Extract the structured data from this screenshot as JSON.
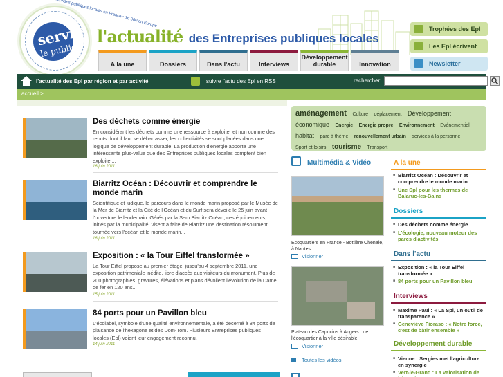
{
  "logo": {
    "line1": "servir",
    "line2": "le public",
    "ring_text": "• 1 100 entreprises publiques locales en France • 16 000 en Europe"
  },
  "site_title": {
    "part1": "l'actualité",
    "part2": "des Entreprises publiques locales"
  },
  "nav": {
    "tabs": [
      {
        "label": "A la une",
        "color": "#f39a1e"
      },
      {
        "label": "Dossiers",
        "color": "#1ba3c6"
      },
      {
        "label": "Dans l'actu",
        "color": "#2f6e8f"
      },
      {
        "label": "Interviews",
        "color": "#8c1a3e"
      },
      {
        "label": "Développement durable",
        "color": "#8bb636"
      },
      {
        "label": "Innovation",
        "color": "#5f7f94"
      }
    ]
  },
  "header_buttons": [
    {
      "label": "Trophées des Epl",
      "bg": "#cfe1a2",
      "fg": "#2f4a1c"
    },
    {
      "label": "Les Epl écrivent",
      "bg": "#cfe1a2",
      "fg": "#2f4a1c"
    },
    {
      "label": "Newsletter",
      "bg": "#cfe6f2",
      "fg": "#2a6f9c"
    }
  ],
  "topbar": {
    "region_label": "l'actualité des Epl par région et par activité",
    "rss_label": "suivre l'actu des Epl en RSS",
    "search_label": "rechercher",
    "search_value": ""
  },
  "breadcrumb": "accueil >",
  "articles": [
    {
      "title": "Des déchets comme énergie",
      "summary": "En considérant les déchets comme une ressource à exploiter et non comme des rebuts dont il faut se débarrasser, les collectivités se sont placées dans une logique de développement durable. La production d'énergie apporte une intéressante plus-value que des Entreprises publiques locales comptent bien exploiter...",
      "date": "16 juin 2011"
    },
    {
      "title": "Biarritz Océan : Découvrir et comprendre le monde marin",
      "summary": "Scientifique et ludique, le parcours dans le monde marin proposé par le Musée de la Mer de Biarritz et la Cité de l'Océan et du Surf sera dévoilé le 25 juin avant l'ouverture le lendemain. Gérés par la Sem Biarritz Océan, ces équipements, initiés par la municipalité, visent à faire de Biarritz une destination résolument tournée vers l'océan et le monde marin...",
      "date": "16 juin 2011"
    },
    {
      "title": "Exposition : « la Tour Eiffel transformée »",
      "summary": "La Tour Eiffel propose au premier étage, jusqu'au 4 septembre 2011, une exposition patrimoniale inédite, libre d'accès aux visiteurs du monument. Plus de 200 photographies, gravures, élévations et plans dévoilent l'évolution de la Dame de fer en 120 ans...",
      "date": "15 juin 2011"
    },
    {
      "title": "84 ports pour un Pavillon bleu",
      "summary": "L'écolabel, symbole d'une qualité environnementale, a été décerné à 84 ports de plaisance de l'hexagone et des Dom-Tom. Plusieurs Entreprises publiques locales (Epl) voient leur engagement reconnu.",
      "date": "14 juin 2011"
    }
  ],
  "tags": [
    {
      "text": "aménagement",
      "size": 11,
      "bold": true
    },
    {
      "text": "Culture",
      "size": 7,
      "bold": false
    },
    {
      "text": "déplacement",
      "size": 7,
      "bold": false
    },
    {
      "text": "Développement",
      "size": 9,
      "bold": false
    },
    {
      "text": "économique",
      "size": 9,
      "bold": false
    },
    {
      "text": "Energie",
      "size": 7,
      "bold": true
    },
    {
      "text": "Energie propre",
      "size": 7,
      "bold": true
    },
    {
      "text": "Environnement",
      "size": 7,
      "bold": true
    },
    {
      "text": "Evénementiel",
      "size": 7,
      "bold": false
    },
    {
      "text": "habitat",
      "size": 9,
      "bold": false
    },
    {
      "text": "parc à thème",
      "size": 7,
      "bold": false
    },
    {
      "text": "renouvellement urbain",
      "size": 7,
      "bold": true
    },
    {
      "text": "services à la personne",
      "size": 7,
      "bold": false
    },
    {
      "text": "Sport et loisirs",
      "size": 7,
      "bold": false
    },
    {
      "text": "tourisme",
      "size": 10,
      "bold": true
    },
    {
      "text": "Transport",
      "size": 7,
      "bold": false
    }
  ],
  "multimedia": {
    "title": "Multimédia & Vidéo",
    "items": [
      {
        "caption": "Ecoquartiers en France - Bottière Chénaie, à Nantes",
        "link": "Visionner"
      },
      {
        "caption": "Plateau des Capucins à Angers : de l'écoquartier à la ville désirable",
        "link": "Visionner"
      }
    ],
    "all_videos": "Toutes les vidéos"
  },
  "news": {
    "sections": [
      {
        "title": "A la une",
        "color": "#f39a1e",
        "items": [
          {
            "text": "Biarritz Océan : Découvrir et comprendre le monde marin",
            "green": false
          },
          {
            "text": "Une Spl pour les thermes de Balaruc-les-Bains",
            "green": true
          }
        ]
      },
      {
        "title": "Dossiers",
        "color": "#1ba3c6",
        "items": [
          {
            "text": "Des déchets comme énergie",
            "green": false
          },
          {
            "text": "L'écologie, nouveau moteur des parcs d'activités",
            "green": true
          }
        ]
      },
      {
        "title": "Dans l'actu",
        "color": "#2f6e8f",
        "items": [
          {
            "text": "Exposition : « la Tour Eiffel transformée »",
            "green": false
          },
          {
            "text": "84 ports pour un Pavillon bleu",
            "green": true
          }
        ]
      },
      {
        "title": "Interviews",
        "color": "#8c1a3e",
        "items": [
          {
            "text": "Maxime Paul : « La Spl, un outil de transparence »",
            "green": false
          },
          {
            "text": "Geneviève Fioraso : « Notre force, c'est de bâtir ensemble »",
            "green": true
          }
        ]
      },
      {
        "title": "Développement durable",
        "color": "#8bb636",
        "items": [
          {
            "text": "Vienne : Sergies met l'agriculture en synergie",
            "green": false
          },
          {
            "text": "Vert-le-Grand : La valorisation de l'énergie augmente",
            "green": true
          }
        ]
      }
    ]
  }
}
